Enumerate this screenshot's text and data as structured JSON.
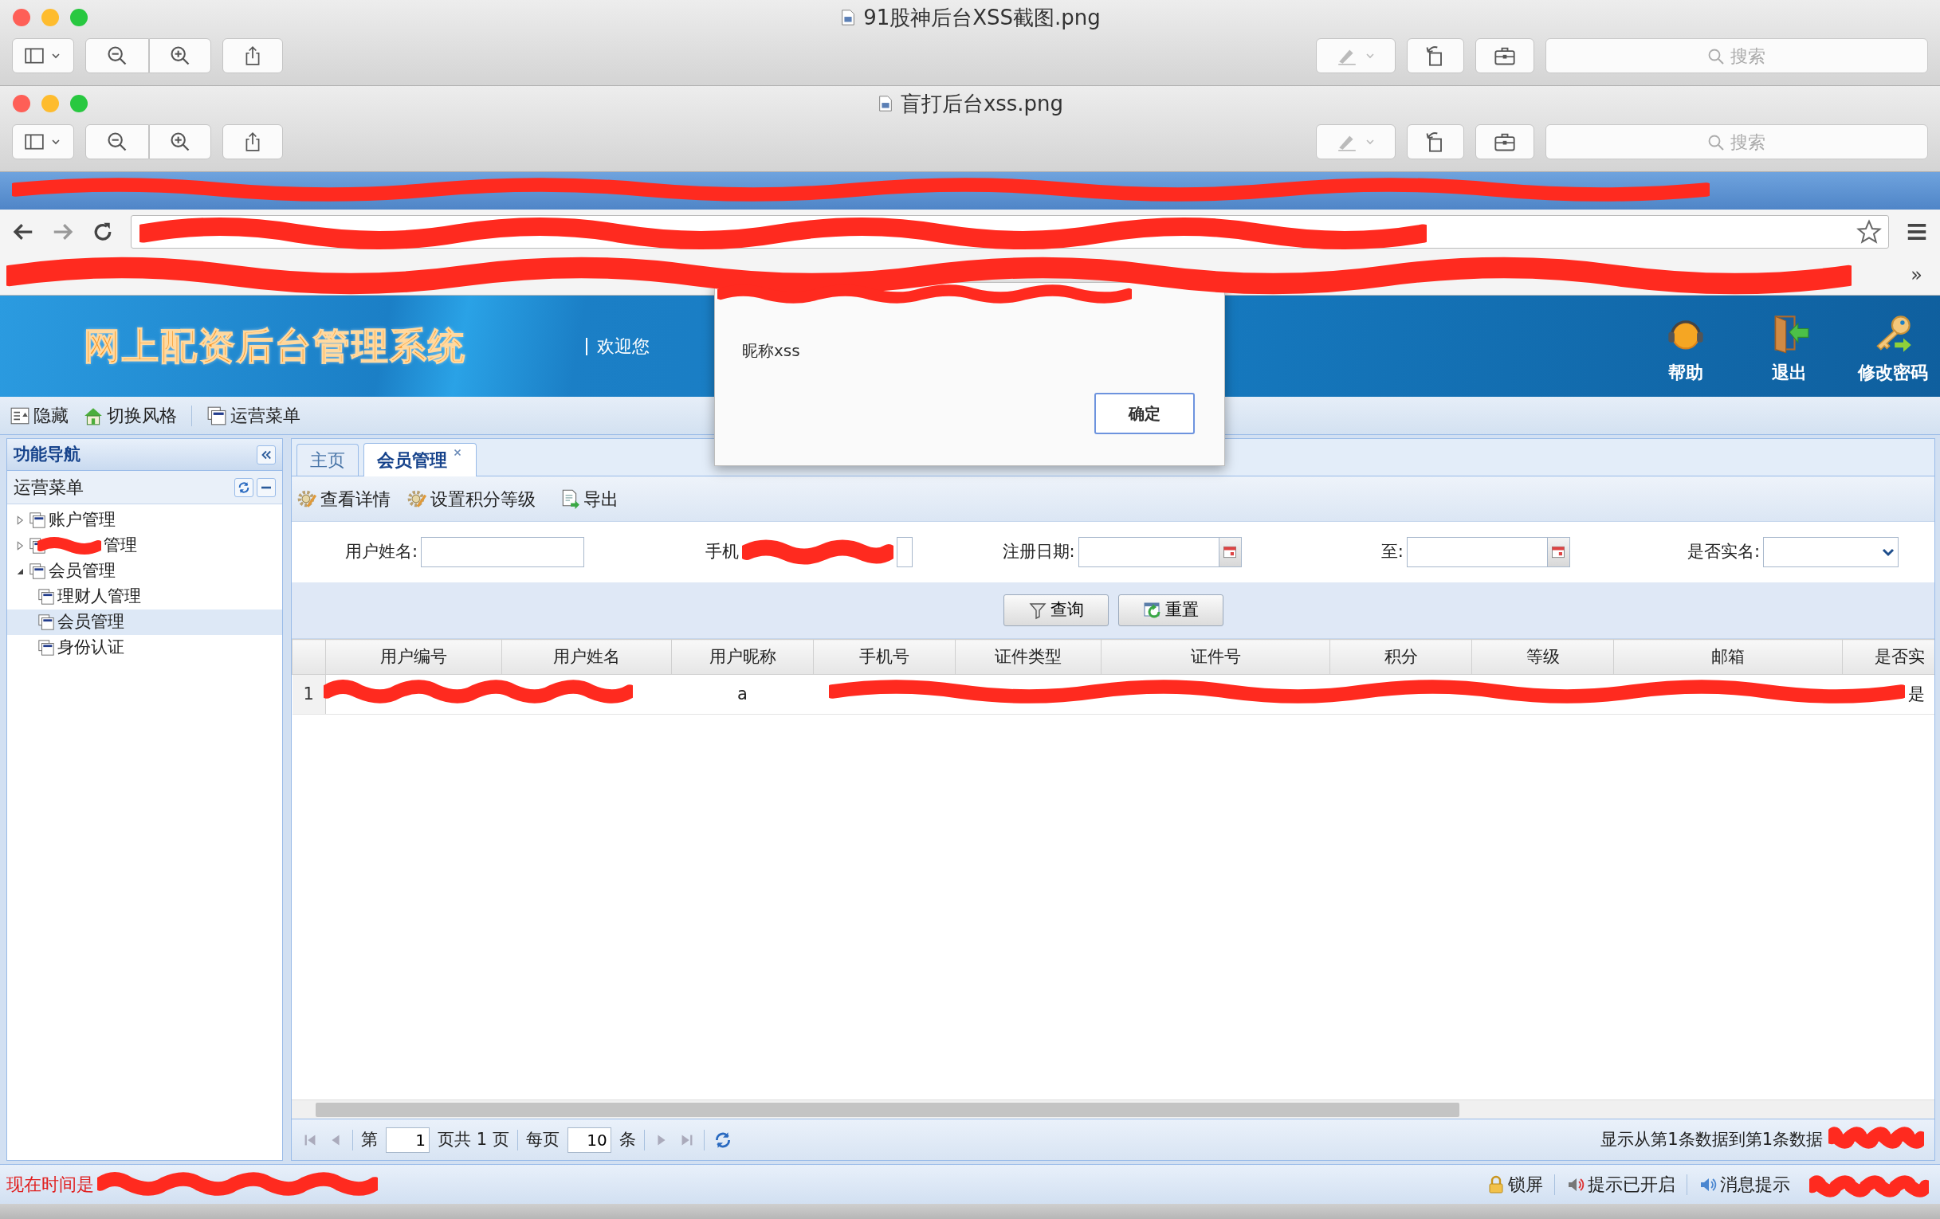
{
  "viewer_windows": [
    {
      "title": "91股神后台XSS截图.png",
      "search_placeholder": "搜索"
    },
    {
      "title": "盲打后台xss.png",
      "search_placeholder": "搜索"
    }
  ],
  "browser": {
    "bookmarks_more": "»"
  },
  "app": {
    "title": "网上配资后台管理系统",
    "welcome": "欢迎您",
    "header_actions": [
      {
        "label": "帮助",
        "kind": "help"
      },
      {
        "label": "退出",
        "kind": "logout"
      },
      {
        "label": "修改密码",
        "kind": "password"
      }
    ],
    "toolbar": [
      {
        "label": "隐藏",
        "kind": "hide"
      },
      {
        "label": "切换风格",
        "kind": "home"
      },
      {
        "label": "运营菜单",
        "kind": "menu"
      }
    ]
  },
  "nav": {
    "title": "功能导航",
    "section": "运营菜单",
    "tree": [
      {
        "label": "账户管理",
        "expanded": false,
        "selected": false,
        "redacted": false
      },
      {
        "label": "管理",
        "expanded": false,
        "selected": false,
        "redacted": true
      },
      {
        "label": "会员管理",
        "expanded": true,
        "selected": false,
        "redacted": false,
        "children": [
          {
            "label": "理财人管理",
            "selected": false
          },
          {
            "label": "会员管理",
            "selected": true
          },
          {
            "label": "身份认证",
            "selected": false
          }
        ]
      }
    ]
  },
  "tabs": [
    {
      "label": "主页",
      "selected": false,
      "closable": false
    },
    {
      "label": "会员管理",
      "selected": true,
      "closable": true
    }
  ],
  "actions": [
    {
      "label": "查看详情",
      "kind": "gear"
    },
    {
      "label": "设置积分等级",
      "kind": "gear"
    },
    {
      "label": "导出",
      "kind": "export"
    }
  ],
  "filters": [
    {
      "label": "用户姓名:",
      "kind": "text",
      "redacted": false
    },
    {
      "label": "手机",
      "kind": "text",
      "redacted": true
    },
    {
      "label": "注册日期:",
      "kind": "date",
      "redacted": false
    },
    {
      "label": "至:",
      "kind": "date",
      "redacted": false
    },
    {
      "label": "是否实名:",
      "kind": "select",
      "redacted": false
    }
  ],
  "search_buttons": [
    {
      "label": "查询",
      "kind": "filter"
    },
    {
      "label": "重置",
      "kind": "reset"
    }
  ],
  "table": {
    "columns": [
      "用户编号",
      "用户姓名",
      "用户昵称",
      "手机号",
      "证件类型",
      "证件号",
      "积分",
      "等级",
      "邮箱",
      "是否实"
    ],
    "rows": [
      {
        "number": "1",
        "nickname": "a",
        "column_10": "是"
      }
    ]
  },
  "pager": {
    "page_label": "第",
    "page": "1",
    "page_suffix": "页共 1 页",
    "per_page_label": "每页",
    "per_page": "10",
    "per_page_suffix": "条",
    "summary": "显示从第1条数据到第1条数据"
  },
  "status_bar": {
    "time_label": "现在时间是",
    "items": [
      {
        "label": "锁屏",
        "kind": "lock"
      },
      {
        "label": "提示已开启",
        "kind": "sound"
      },
      {
        "label": "消息提示",
        "kind": "message"
      }
    ]
  },
  "dialog": {
    "message": "昵称xss",
    "button": "确定"
  }
}
